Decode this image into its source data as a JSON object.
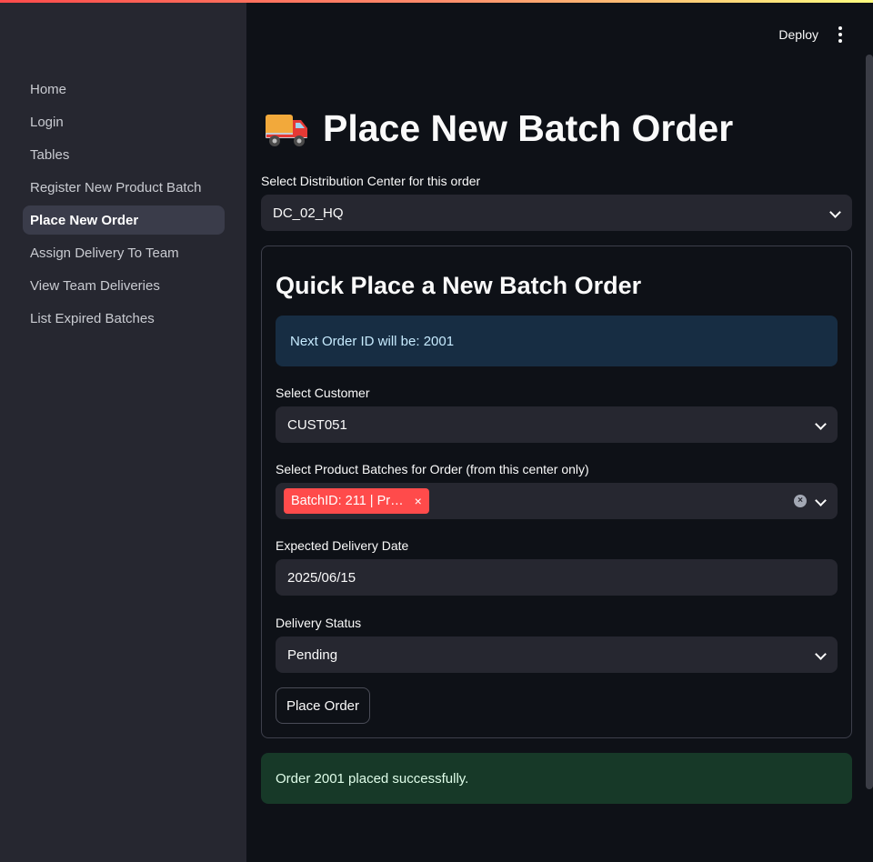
{
  "header": {
    "deploy_label": "Deploy"
  },
  "sidebar": {
    "items": [
      {
        "label": "Home"
      },
      {
        "label": "Login"
      },
      {
        "label": "Tables"
      },
      {
        "label": "Register New Product Batch"
      },
      {
        "label": "Place New Order",
        "active": true
      },
      {
        "label": "Assign Delivery To Team"
      },
      {
        "label": "View Team Deliveries"
      },
      {
        "label": "List Expired Batches"
      }
    ]
  },
  "page": {
    "title": "Place New Batch Order",
    "title_icon": "delivery-truck-emoji",
    "dc_label": "Select Distribution Center for this order",
    "dc_value": "DC_02_HQ"
  },
  "form": {
    "title": "Quick Place a New Batch Order",
    "info_text": "Next Order ID will be: 2001",
    "customer_label": "Select Customer",
    "customer_value": "CUST051",
    "batches_label": "Select Product Batches for Order (from this center only)",
    "batch_tag": "BatchID: 211 | Pr…",
    "tag_remove": "×",
    "clear_all": "×",
    "date_label": "Expected Delivery Date",
    "date_value": "2025/06/15",
    "status_label": "Delivery Status",
    "status_value": "Pending",
    "submit_label": "Place Order"
  },
  "success_text": "Order 2001 placed successfully.",
  "colors": {
    "accent": "#ff4b4b",
    "sidebar_bg": "#262730",
    "app_bg": "#0e1117",
    "info_bg": "#172d43",
    "success_bg": "#173928"
  }
}
